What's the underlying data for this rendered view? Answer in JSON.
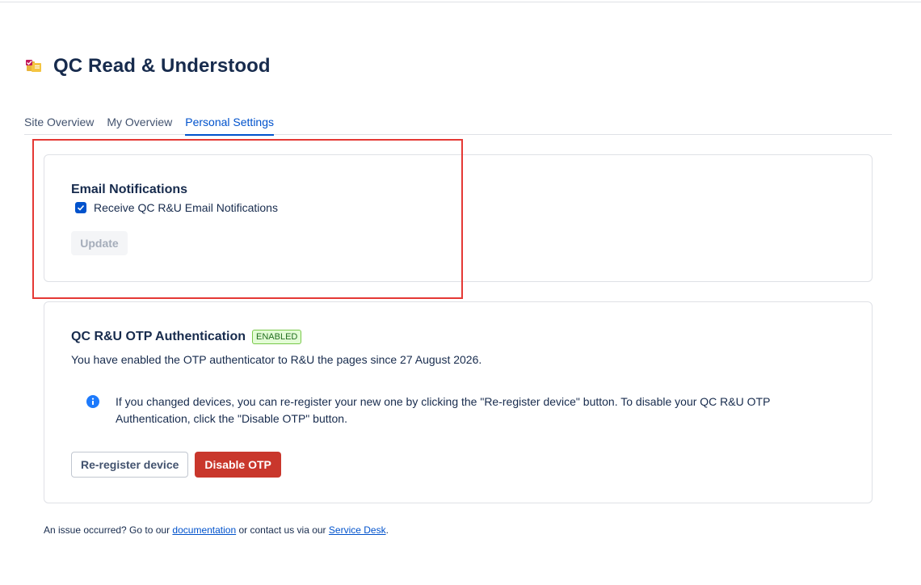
{
  "app": {
    "title": "QC Read & Understood",
    "icon": "app-logo-icon"
  },
  "tabs": [
    {
      "label": "Site Overview",
      "active": false
    },
    {
      "label": "My Overview",
      "active": false
    },
    {
      "label": "Personal Settings",
      "active": true
    }
  ],
  "email_section": {
    "title": "Email Notifications",
    "checkbox_label": "Receive QC R&U Email Notifications",
    "checkbox_checked": true,
    "update_label": "Update",
    "update_disabled": true
  },
  "otp_section": {
    "title": "QC R&U OTP Authentication",
    "status_badge": "ENABLED",
    "description": "You have enabled the OTP authenticator to R&U the pages since 27 August 2026.",
    "info_text": "If you changed devices, you can re-register your new one by clicking the \"Re-register device\" button. To disable your QC R&U OTP Authentication, click the \"Disable OTP\" button.",
    "reregister_label": "Re-register device",
    "disable_label": "Disable OTP"
  },
  "footer": {
    "prefix": "An issue occurred? Go to our ",
    "doc_link": "documentation",
    "middle": " or contact us via our ",
    "desk_link": "Service Desk",
    "suffix": "."
  },
  "colors": {
    "accent": "#0052cc",
    "danger": "#c9372c",
    "success_bg": "#e3fcd6",
    "highlight": "#e53935"
  }
}
